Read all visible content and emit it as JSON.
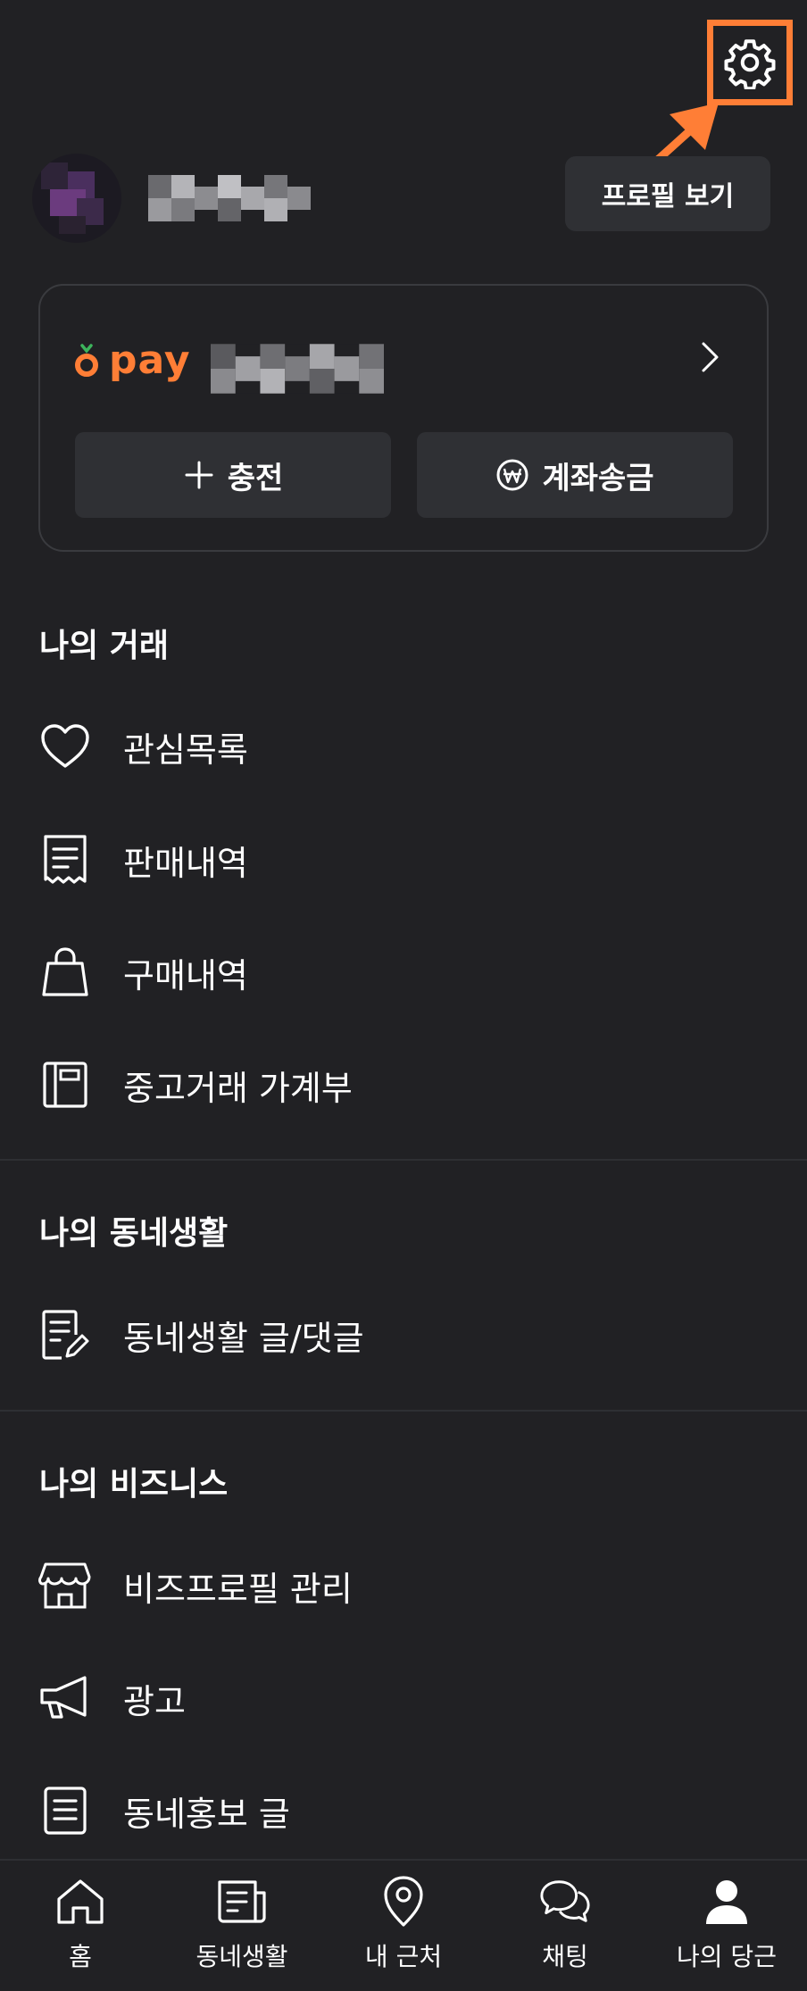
{
  "profile": {
    "view_button": "프로필 보기"
  },
  "pay": {
    "brand": "pay",
    "charge_label": "충전",
    "transfer_label": "계좌송금",
    "accent": "#ff7e36"
  },
  "sections": {
    "trade": {
      "title": "나의 거래",
      "items": [
        {
          "label": "관심목록",
          "icon": "heart-icon"
        },
        {
          "label": "판매내역",
          "icon": "receipt-icon"
        },
        {
          "label": "구매내역",
          "icon": "shopping-bag-icon"
        },
        {
          "label": "중고거래 가계부",
          "icon": "ledger-book-icon"
        }
      ]
    },
    "community": {
      "title": "나의 동네생활",
      "items": [
        {
          "label": "동네생활 글/댓글",
          "icon": "document-edit-icon"
        }
      ]
    },
    "business": {
      "title": "나의 비즈니스",
      "items": [
        {
          "label": "비즈프로필 관리",
          "icon": "storefront-icon"
        },
        {
          "label": "광고",
          "icon": "megaphone-icon"
        },
        {
          "label": "동네홍보 글",
          "icon": "document-list-icon"
        }
      ]
    }
  },
  "bottom_nav": [
    {
      "label": "홈",
      "icon": "home-icon"
    },
    {
      "label": "동네생활",
      "icon": "newspaper-icon"
    },
    {
      "label": "내 근처",
      "icon": "location-pin-icon"
    },
    {
      "label": "채팅",
      "icon": "chat-bubbles-icon"
    },
    {
      "label": "나의 당근",
      "icon": "person-icon",
      "active": true
    }
  ],
  "colors": {
    "background": "#212124",
    "surface": "#2f3034",
    "highlight": "#ff7e36"
  }
}
